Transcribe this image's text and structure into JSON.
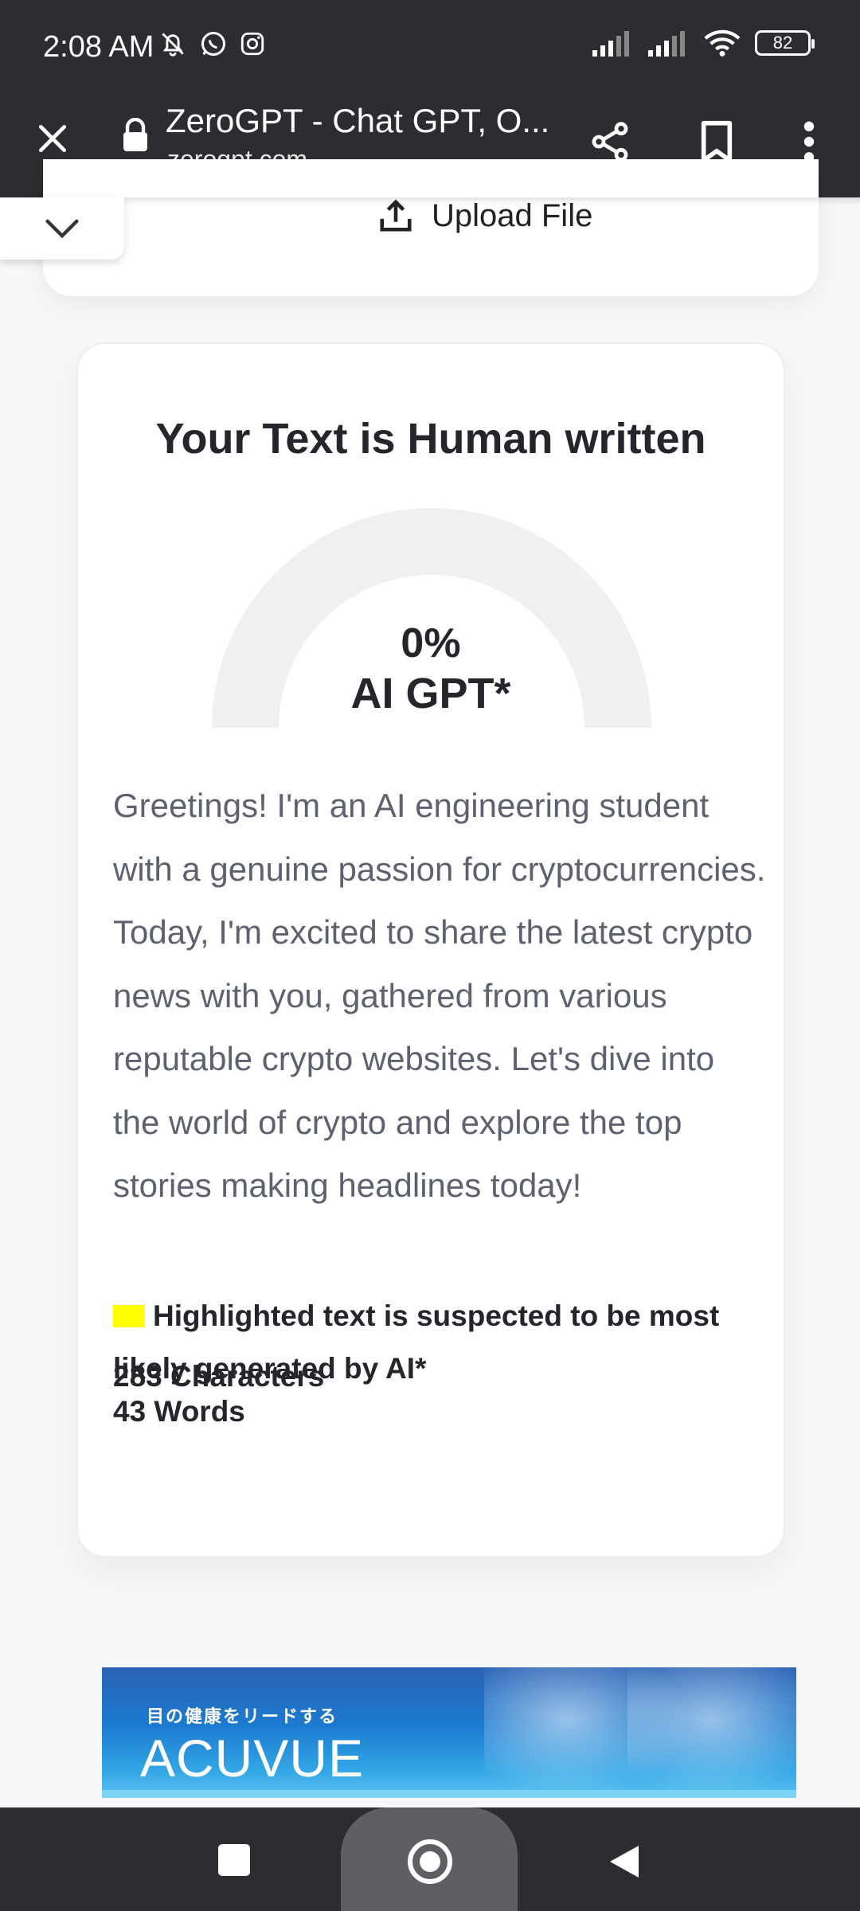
{
  "status_bar": {
    "time": "2:08 AM",
    "battery": "82"
  },
  "browser": {
    "title": "ZeroGPT - Chat GPT, O...",
    "domain": "zerogpt.com"
  },
  "upload": {
    "label": "Upload File"
  },
  "result": {
    "title": "Your Text is Human written",
    "percent": "0%",
    "percent_value": 0,
    "gauge_label": "AI GPT*",
    "text": "Greetings! I'm an AI engineering student with a genuine passion for cryptocurrencies. Today, I'm excited to share the latest crypto news with you, gathered from various reputable crypto websites. Let's dive into the world of crypto and explore the top stories making headlines today!",
    "legend": "Highlighted text is suspected to be most likely generated by AI*",
    "characters": "283 Characters",
    "words": "43 Words"
  },
  "ad": {
    "tagline": "目の健康をリードする",
    "brand": "ACUVUE"
  },
  "colors": {
    "bar_bg": "#2c2d31",
    "highlight": "#ffff00",
    "gauge_track": "#f0f0f0",
    "ad_blue": "#1b7bd0"
  }
}
